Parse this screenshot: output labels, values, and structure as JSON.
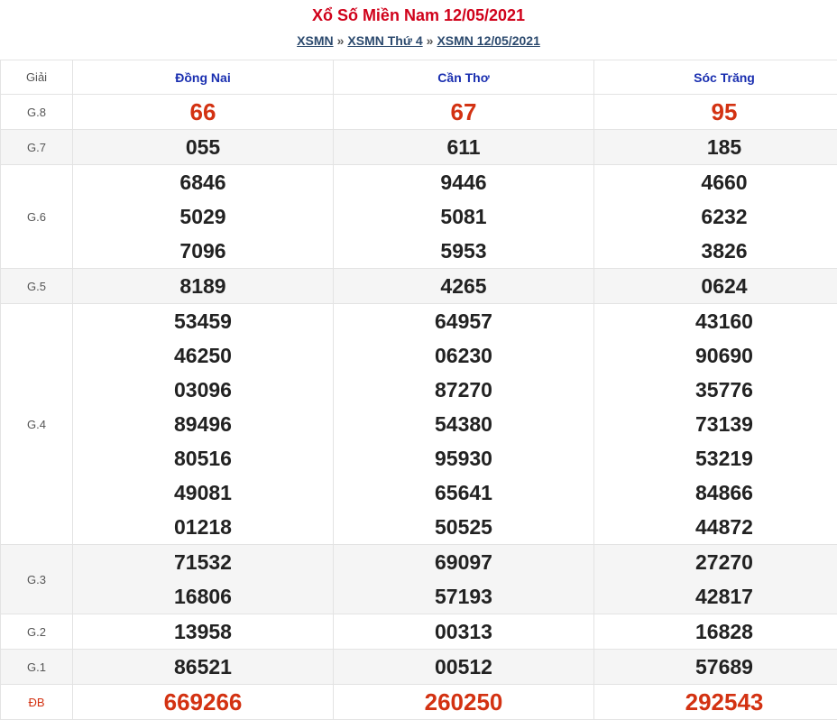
{
  "page": {
    "title": "Xổ Số Miền Nam 12/05/2021",
    "breadcrumb": [
      {
        "label": "XSMN"
      },
      {
        "label": "XSMN Thứ 4"
      },
      {
        "label": "XSMN 12/05/2021"
      }
    ],
    "separator": "»"
  },
  "table": {
    "header_label": "Giải",
    "provinces": [
      "Đồng Nai",
      "Cần Thơ",
      "Sóc Trăng"
    ],
    "rows": [
      {
        "label": "G.8",
        "values": [
          [
            "66"
          ],
          [
            "67"
          ],
          [
            "95"
          ]
        ],
        "highlight": true
      },
      {
        "label": "G.7",
        "values": [
          [
            "055"
          ],
          [
            "611"
          ],
          [
            "185"
          ]
        ]
      },
      {
        "label": "G.6",
        "values": [
          [
            "6846",
            "5029",
            "7096"
          ],
          [
            "9446",
            "5081",
            "5953"
          ],
          [
            "4660",
            "6232",
            "3826"
          ]
        ]
      },
      {
        "label": "G.5",
        "values": [
          [
            "8189"
          ],
          [
            "4265"
          ],
          [
            "0624"
          ]
        ]
      },
      {
        "label": "G.4",
        "values": [
          [
            "53459",
            "46250",
            "03096",
            "89496",
            "80516",
            "49081",
            "01218"
          ],
          [
            "64957",
            "06230",
            "87270",
            "54380",
            "95930",
            "65641",
            "50525"
          ],
          [
            "43160",
            "90690",
            "35776",
            "73139",
            "53219",
            "84866",
            "44872"
          ]
        ]
      },
      {
        "label": "G.3",
        "values": [
          [
            "71532",
            "16806"
          ],
          [
            "69097",
            "57193"
          ],
          [
            "27270",
            "42817"
          ]
        ]
      },
      {
        "label": "G.2",
        "values": [
          [
            "13958"
          ],
          [
            "00313"
          ],
          [
            "16828"
          ]
        ]
      },
      {
        "label": "G.1",
        "values": [
          [
            "86521"
          ],
          [
            "00512"
          ],
          [
            "57689"
          ]
        ]
      },
      {
        "label": "ĐB",
        "values": [
          [
            "669266"
          ],
          [
            "260250"
          ],
          [
            "292543"
          ]
        ],
        "highlight": true
      }
    ]
  }
}
